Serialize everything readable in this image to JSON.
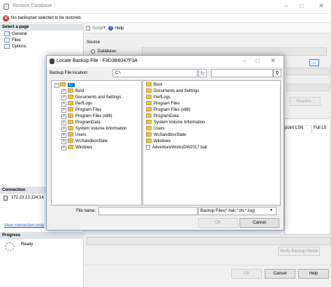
{
  "window": {
    "title": "Restore Database -",
    "message": "No backupset selected to be restored."
  },
  "left_pane": {
    "select_page": "Select a page",
    "pages": [
      "General",
      "Files",
      "Options"
    ],
    "connection_header": "Connection",
    "connection_server": "172.23.13.124.14",
    "view_connection_link": "View connection prop",
    "progress_header": "Progress",
    "progress_status": "Ready"
  },
  "toolbar": {
    "script": "Script",
    "help": "Help"
  },
  "source": {
    "label": "Source",
    "database_option": "Database:",
    "browse": "...",
    "timeline": "Timeline..."
  },
  "backup_grid": {
    "col_point_lsn": "point LSN",
    "col_full_ls": "Full LS"
  },
  "verify_button": "Verify Backup Media",
  "footer": {
    "ok": "OK",
    "cancel": "Cancel",
    "help": "Help"
  },
  "dialog": {
    "title": "Locate Backup File - F3D3B6047F3A",
    "location_label": "Backup File location:",
    "location_value": "C:\\",
    "search_value": "",
    "tree_root": "C:",
    "tree": [
      "Boot",
      "Documents and Settings",
      "PerfLogs",
      "Program Files",
      "Program Files (x86)",
      "ProgramData",
      "System Volume Information",
      "Users",
      "WcSandboxState",
      "Windows"
    ],
    "folders": [
      "Boot",
      "Documents and Settings",
      "PerfLogs",
      "Program Files",
      "Program Files (x86)",
      "ProgramData",
      "System Volume Information",
      "Users",
      "WcSandboxState",
      "Windows"
    ],
    "files": [
      "AdventureWorksDW2017.bak"
    ],
    "file_name_label": "File name:",
    "file_name_value": "",
    "filter": "Backup Files(*.bak;*.tm;*.log)",
    "ok": "OK",
    "cancel": "Cancel"
  }
}
